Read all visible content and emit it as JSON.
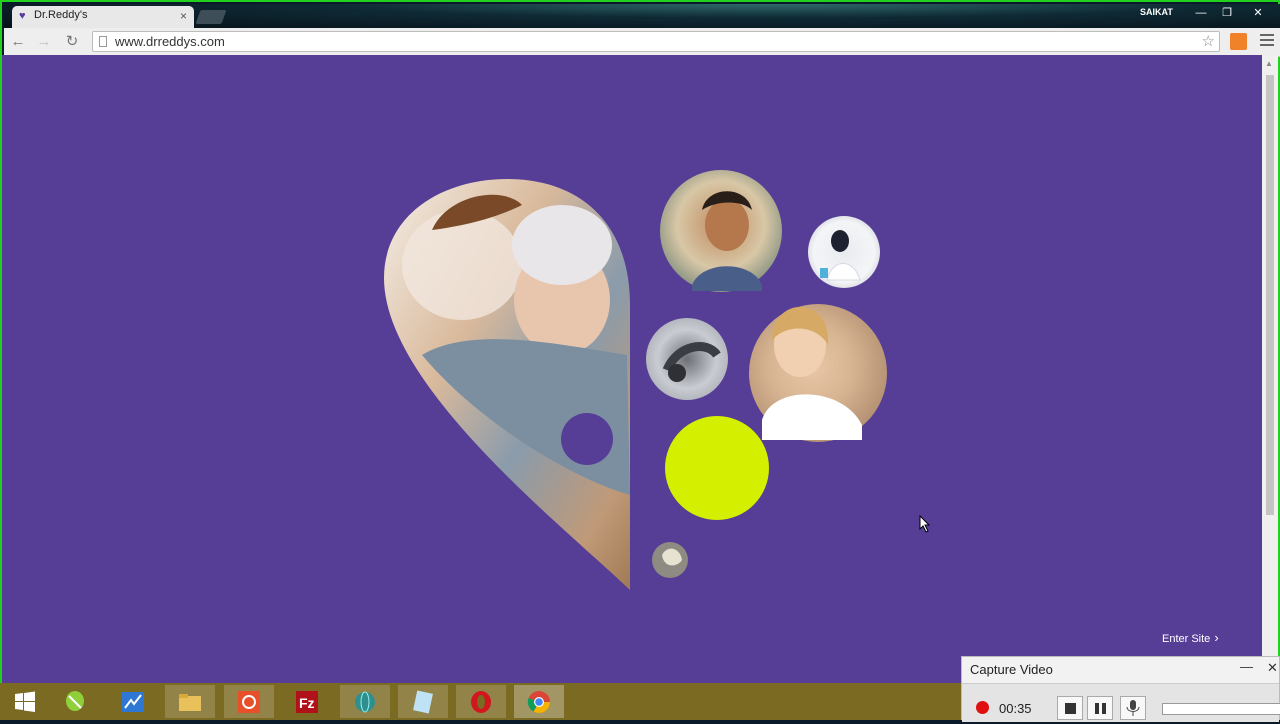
{
  "browser": {
    "tab_title": "Dr.Reddy's",
    "tab_close": "×",
    "user_name": "SAIKAT",
    "url": "www.drreddys.com",
    "back_glyph": "←",
    "forward_glyph": "→",
    "reload_glyph": "↻",
    "star_glyph": "☆",
    "min_glyph": "—",
    "restore_glyph": "❐",
    "close_glyph": "✕"
  },
  "page": {
    "background": "#563d96",
    "accent": "#d4ef00",
    "enter_site": "Enter Site",
    "enter_chevron": "›"
  },
  "taskbar": {
    "items": [
      "windows-start",
      "corel-draw",
      "word-press-app",
      "file-explorer",
      "screen-recorder",
      "filezilla",
      "vpn-globe",
      "notepad",
      "opera",
      "chrome"
    ]
  },
  "capture": {
    "title": "Capture Video",
    "minimize": "—",
    "close": "✕",
    "timer": "00:35"
  }
}
